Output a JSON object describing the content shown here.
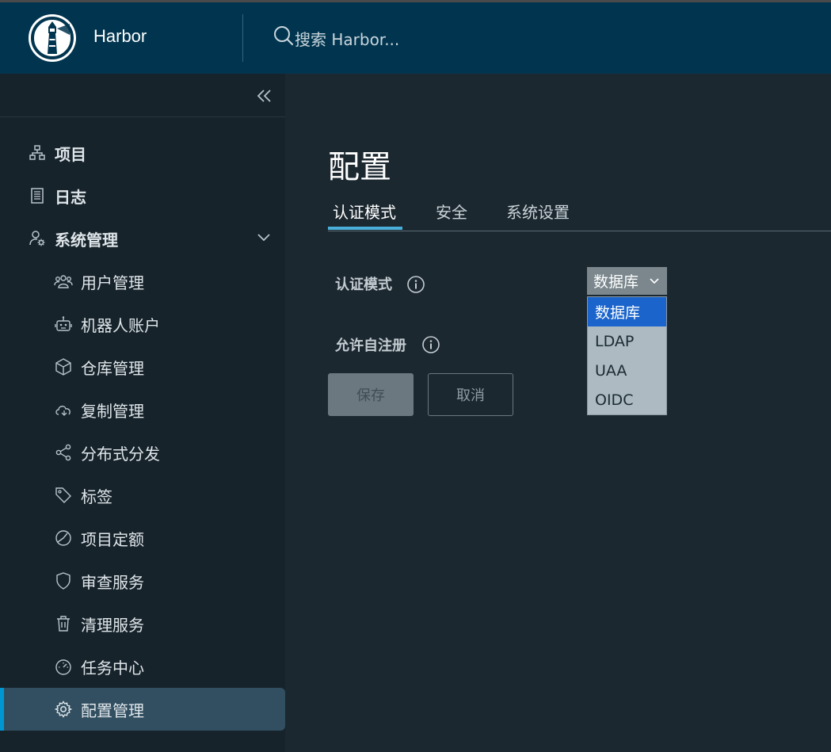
{
  "header": {
    "app_name": "Harbor",
    "search_placeholder": "搜索 Harbor..."
  },
  "sidebar": {
    "collapse_icon": "double-chevron-left-icon",
    "top_items": [
      {
        "label": "项目",
        "icon": "projects-icon"
      },
      {
        "label": "日志",
        "icon": "logs-icon"
      },
      {
        "label": "系统管理",
        "icon": "admin-user-gear-icon"
      }
    ],
    "sub_items": [
      {
        "label": "用户管理",
        "icon": "users-icon"
      },
      {
        "label": "机器人账户",
        "icon": "robot-icon"
      },
      {
        "label": "仓库管理",
        "icon": "cube-icon"
      },
      {
        "label": "复制管理",
        "icon": "cloud-sync-icon"
      },
      {
        "label": "分布式分发",
        "icon": "share-icon"
      },
      {
        "label": "标签",
        "icon": "tag-icon"
      },
      {
        "label": "项目定额",
        "icon": "pie-chart-icon"
      },
      {
        "label": "审查服务",
        "icon": "shield-icon"
      },
      {
        "label": "清理服务",
        "icon": "trash-icon"
      },
      {
        "label": "任务中心",
        "icon": "dashboard-gauge-icon"
      },
      {
        "label": "配置管理",
        "icon": "gear-icon",
        "active": true
      }
    ]
  },
  "main": {
    "title": "配置",
    "tabs": [
      {
        "label": "认证模式",
        "active": true
      },
      {
        "label": "安全"
      },
      {
        "label": "系统设置"
      }
    ],
    "fields": {
      "auth_mode_label": "认证模式",
      "self_register_label": "允许自注册"
    },
    "auth_select": {
      "value": "数据库",
      "options": [
        "数据库",
        "LDAP",
        "UAA",
        "OIDC"
      ],
      "highlighted": "数据库"
    },
    "buttons": {
      "save": "保存",
      "cancel": "取消"
    }
  },
  "colors": {
    "header_bg": "#01354f",
    "sidebar_bg": "#17232b",
    "content_bg": "#1c2830",
    "accent": "#49afd9",
    "active_nav_bg": "#324f61",
    "dropdown_selected": "#1a64cc"
  }
}
